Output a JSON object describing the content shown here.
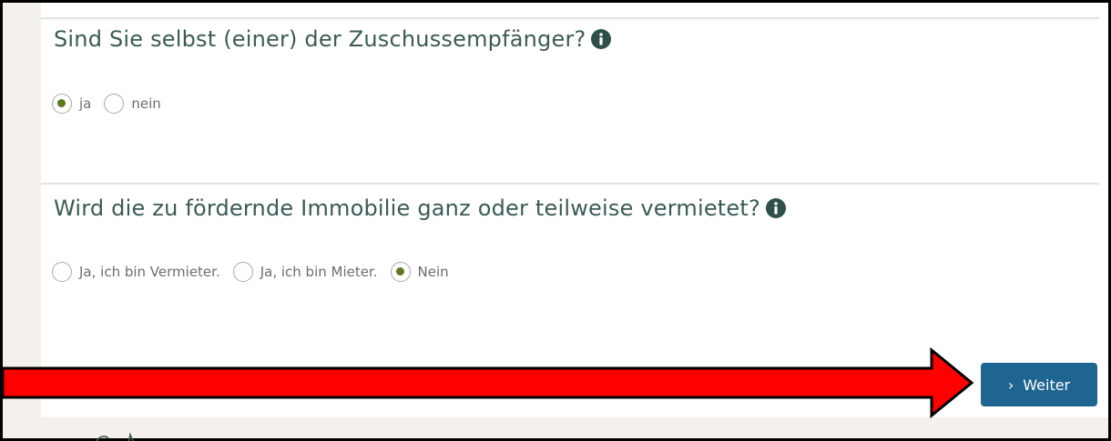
{
  "questions": [
    {
      "text": "Sind Sie selbst (einer) der Zuschussempfänger?",
      "options": [
        {
          "label": "ja",
          "checked": true
        },
        {
          "label": "nein",
          "checked": false
        }
      ]
    },
    {
      "text": "Wird die zu fördernde Immobilie ganz oder teilweise vermietet?",
      "options": [
        {
          "label": "Ja, ich bin Vermieter.",
          "checked": false
        },
        {
          "label": "Ja, ich bin Mieter.",
          "checked": false
        },
        {
          "label": "Nein",
          "checked": true
        }
      ]
    }
  ],
  "next_button": {
    "label": "Weiter",
    "chevron": "›"
  },
  "colors": {
    "accent": "#1f6591",
    "radio_selected": "#5b7a1d",
    "question_text": "#3b5b56",
    "annotation_arrow": "#ff0000"
  },
  "icons": {
    "info": "info-circle-icon",
    "annotation": "red-arrow-icon"
  }
}
